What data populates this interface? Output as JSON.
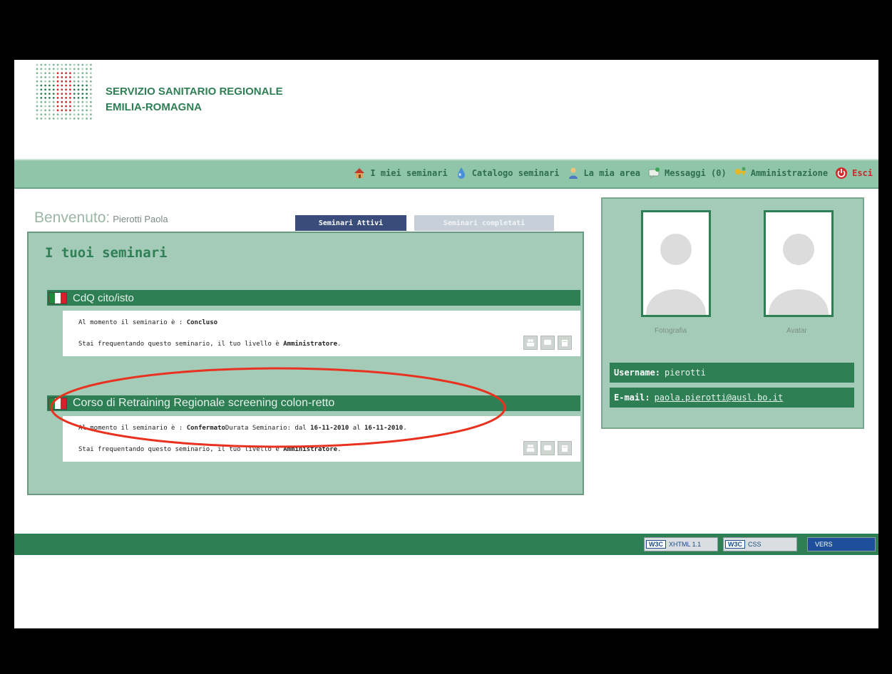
{
  "header": {
    "line1": "SERVIZIO SANITARIO REGIONALE",
    "line2": "EMILIA-ROMAGNA"
  },
  "nav": {
    "items": [
      {
        "label": "I miei seminari",
        "icon": "house-icon"
      },
      {
        "label": "Catalogo seminari",
        "icon": "drop-icon"
      },
      {
        "label": "La mia area",
        "icon": "user-icon"
      },
      {
        "label": "Messaggi (0)",
        "icon": "message-icon"
      },
      {
        "label": "Amministrazione",
        "icon": "key-icon"
      },
      {
        "label": "Esci",
        "icon": "power-icon"
      }
    ]
  },
  "welcome": {
    "label": "Benvenuto:",
    "name": "Pierotti Paola"
  },
  "tabs": {
    "active": "Seminari Attivi",
    "completed": "Seminari completati"
  },
  "panel": {
    "title": "I tuoi seminari"
  },
  "seminars": [
    {
      "title": "CdQ cito/isto",
      "status_prefix": "Al momento il seminario è : ",
      "status": "Concluso",
      "duration_label": "",
      "date_from": "",
      "date_to": "",
      "level_prefix": "Stai frequentando questo seminario, il tuo livello è ",
      "level": "Amministratore",
      "level_suffix": "."
    },
    {
      "title": "Corso di Retraining Regionale screening colon-retto",
      "status_prefix": "Al momento il seminario è : ",
      "status": "Confermato",
      "duration_label": "Durata Seminario: dal ",
      "date_from": "16-11-2010",
      "date_sep": " al ",
      "date_to": "16-11-2010",
      "date_suffix": ".",
      "level_prefix": "Stai frequentando questo seminario, il tuo livello è ",
      "level": "Amministratore",
      "level_suffix": "."
    }
  ],
  "profile": {
    "photo_caption": "Fotografia",
    "avatar_caption": "Avatar",
    "username_label": "Username:",
    "username": "pierotti",
    "email_label": "E-mail:",
    "email": "paola.pierotti@ausl.bo.it"
  },
  "footer": {
    "badges": [
      {
        "mark": "W3C",
        "text": "XHTML 1.1"
      },
      {
        "mark": "W3C",
        "text": "CSS"
      },
      {
        "mark": "",
        "text": "VERS"
      }
    ]
  },
  "colors": {
    "brand_green": "#2f7f55",
    "panel_green": "#a3cbb7",
    "tab_active": "#3a4d7a",
    "highlight": "#e8321f"
  }
}
